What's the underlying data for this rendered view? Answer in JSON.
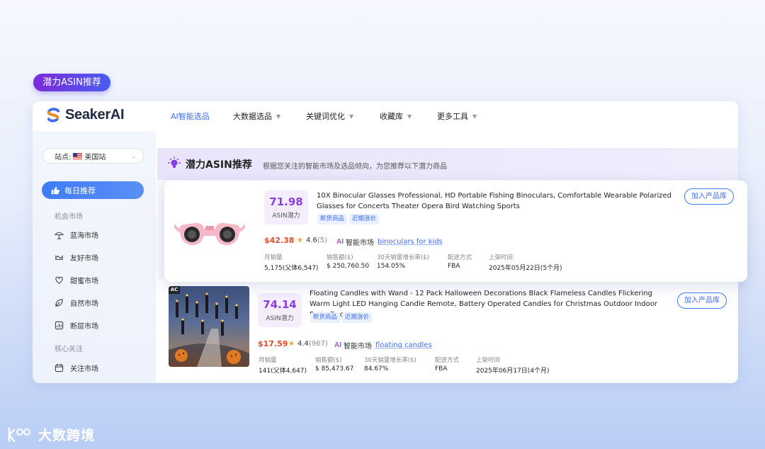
{
  "badge": "潜力ASIN推荐",
  "logo": {
    "text": "SeakerAI"
  },
  "nav": [
    {
      "label": "AI智能选品",
      "active": true,
      "dropdown": false
    },
    {
      "label": "大数据选品",
      "active": false,
      "dropdown": true
    },
    {
      "label": "关键词优化",
      "active": false,
      "dropdown": true
    },
    {
      "label": "收藏库",
      "active": false,
      "dropdown": true
    },
    {
      "label": "更多工具",
      "active": false,
      "dropdown": true
    }
  ],
  "sidebar": {
    "site_label": "站点:",
    "site_value": "美国站",
    "active_item": "每日推荐",
    "group1": "机会市场",
    "items1": [
      "蓝海市场",
      "友好市场",
      "甜蜜市场",
      "自然市场",
      "断层市场"
    ],
    "group2": "核心关注",
    "items2": [
      "关注市场"
    ]
  },
  "header": {
    "title": "潜力ASIN推荐",
    "description": "根据您关注的智能市场及选品倾向，为您推荐以下潜力商品"
  },
  "metric_labels": [
    "月销量",
    "销售额($)",
    "30天销量增长率($)",
    "配送方式",
    "上架时间"
  ],
  "products": [
    {
      "score": "71.98",
      "score_label": "ASIN潜力",
      "title": "10X Binocular Glasses Professional, HD Portable Fishing Binoculars, Comfortable Wearable Polarized Glasses for Concerts Theater Opera Bird Watching Sports",
      "tags": [
        "断货商品",
        "近期涨价"
      ],
      "add_button": "加入产品库",
      "price": "$42.38",
      "rating": "4.6",
      "rating_count": "(5)",
      "market_label": "智能市场",
      "market_keyword": "binoculars for kids",
      "metrics": [
        "5,175(父体6,547)",
        "$ 250,760.50",
        "154.05%",
        "FBA",
        "2025年05月22日(5个月)"
      ]
    },
    {
      "score": "74.14",
      "score_label": "ASIN潜力",
      "title": "Floating Candles with Wand - 12 Pack Halloween Decorations Black Flameless Candles Flickering Warm Light LED Hanging Candle Remote, Battery Operated Candles for Christmas Outdoor Indoor Party Decor",
      "tags": [
        "断货商品",
        "近期涨价"
      ],
      "add_button": "加入产品库",
      "price": "$17.59",
      "rating": "4.4",
      "rating_count": "(967)",
      "market_label": "智能市场",
      "market_keyword": "floating candles",
      "metrics": [
        "141(父体4,647)",
        "$ 85,473.67",
        "84.67%",
        "FBA",
        "2025年06月17日(4个月)"
      ],
      "image_tag": "AC"
    }
  ],
  "watermark": "大数跨境",
  "colors": {
    "accent": "#3f6cf2",
    "score": "#8a3ee0",
    "price": "#e24b2a"
  }
}
